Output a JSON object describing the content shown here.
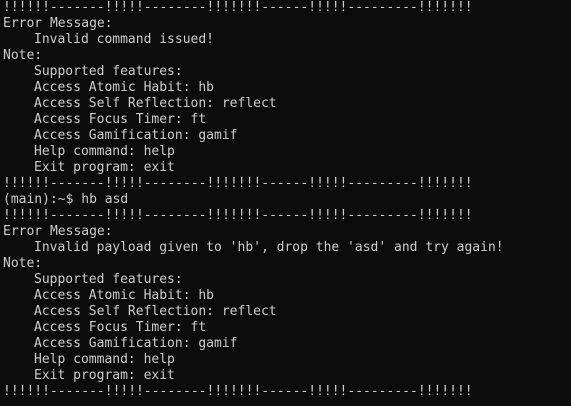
{
  "separator": "!!!!!!-------!!!!!--------!!!!!!!------!!!!!---------!!!!!!!",
  "blocks": [
    {
      "error_header": "Error Message:",
      "error_text": "Invalid command issued!",
      "note_header": "Note:",
      "features": [
        "Supported features:",
        "Access Atomic Habit: hb",
        "Access Self Reflection: reflect",
        "Access Focus Timer: ft",
        "Access Gamification: gamif",
        "Help command: help",
        "Exit program: exit"
      ]
    },
    {
      "error_header": "Error Message:",
      "error_text": "Invalid payload given to 'hb', drop the 'asd' and try again!",
      "note_header": "Note:",
      "features": [
        "Supported features:",
        "Access Atomic Habit: hb",
        "Access Self Reflection: reflect",
        "Access Focus Timer: ft",
        "Access Gamification: gamif",
        "Help command: help",
        "Exit program: exit"
      ]
    }
  ],
  "prompt": {
    "text": "(main):~$ ",
    "command": "hb asd"
  }
}
